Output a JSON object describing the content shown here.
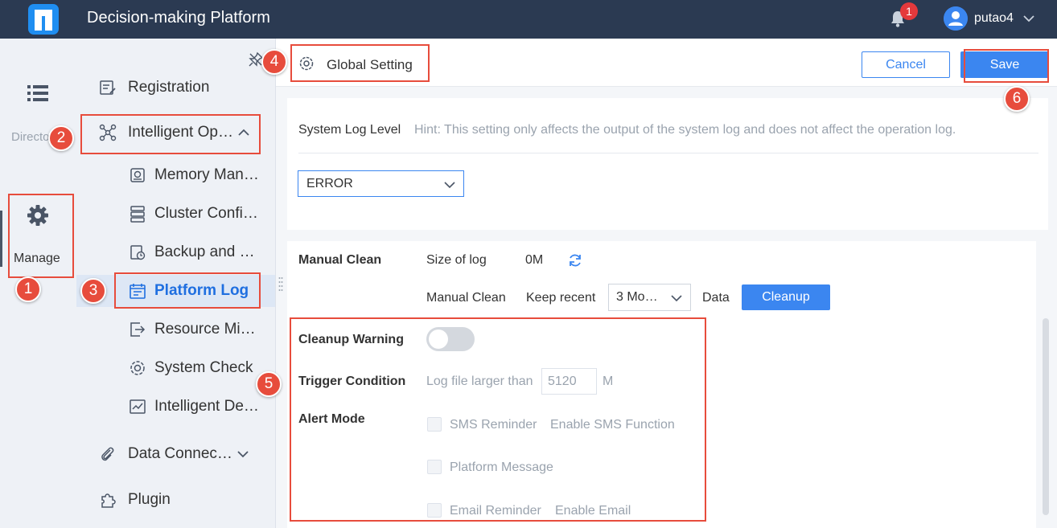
{
  "topbar": {
    "title": "Decision-making Platform",
    "notification_count": "1",
    "username": "putao4",
    "icons": [
      "logo",
      "bell-icon",
      "user-avatar-icon",
      "chevron-down-icon"
    ]
  },
  "rail": {
    "directory_label": "Directo",
    "manage_label": "Manage"
  },
  "nav": {
    "items": [
      {
        "label": "Registration",
        "icon": "registration-icon"
      },
      {
        "label": "Intelligent Op…",
        "icon": "intelligent-ops-icon",
        "expanded": true
      },
      {
        "label": "Memory Man…",
        "icon": "memory-icon"
      },
      {
        "label": "Cluster Confi…",
        "icon": "cluster-icon"
      },
      {
        "label": "Backup and …",
        "icon": "backup-icon"
      },
      {
        "label": "Platform Log",
        "icon": "platform-log-icon",
        "selected": true
      },
      {
        "label": "Resource Mi…",
        "icon": "resource-migration-icon"
      },
      {
        "label": "System Check",
        "icon": "system-check-icon"
      },
      {
        "label": "Intelligent De…",
        "icon": "intelligent-detect-icon"
      },
      {
        "label": "Data Connec…",
        "icon": "data-connection-icon"
      },
      {
        "label": "Plugin",
        "icon": "plugin-icon"
      }
    ]
  },
  "header": {
    "title": "Global Setting",
    "cancel_label": "Cancel",
    "save_label": "Save"
  },
  "system_log": {
    "label": "System Log Level",
    "hint": "Hint: This setting only affects the output of the system log and does not affect the operation log.",
    "level_value": "ERROR"
  },
  "manual_clean": {
    "section_label": "Manual Clean",
    "size_label": "Size of log",
    "size_value": "0M",
    "row_label": "Manual Clean",
    "keep_recent_label": "Keep recent",
    "keep_recent_value": "3 Mo…",
    "data_label": "Data",
    "cleanup_button": "Cleanup"
  },
  "cleanup_warning": {
    "label": "Cleanup Warning",
    "enabled": false,
    "trigger_label": "Trigger Condition",
    "trigger_text": "Log file larger than",
    "trigger_value": "5120",
    "trigger_unit": "M",
    "alert_label": "Alert Mode",
    "sms_label": "SMS Reminder",
    "sms_hint": "Enable SMS Function",
    "platform_message_label": "Platform Message",
    "email_label": "Email Reminder",
    "email_hint": "Enable Email"
  },
  "annotations": [
    "1",
    "2",
    "3",
    "4",
    "5",
    "6"
  ],
  "colors": {
    "topbar": "#2b3a52",
    "accent": "#3b86f0",
    "annotation": "#e74c3c",
    "sidebar": "#eef1f6"
  }
}
